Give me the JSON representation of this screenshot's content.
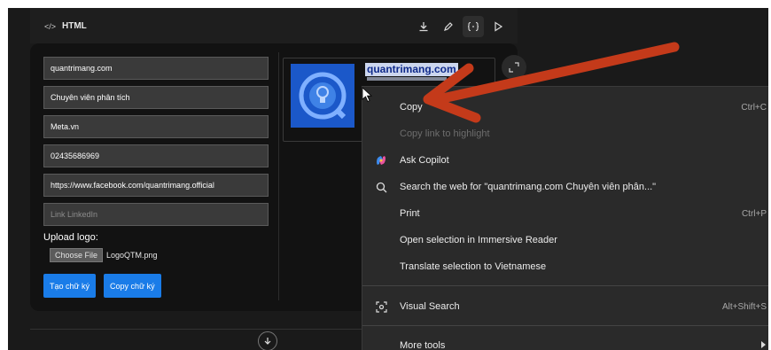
{
  "panel": {
    "title": "HTML"
  },
  "form": {
    "fields": [
      {
        "value": "quantrimang.com"
      },
      {
        "value": "Chuyên viên phân tích"
      },
      {
        "value": "Meta.vn"
      },
      {
        "value": "02435686969"
      },
      {
        "value": "https://www.facebook.com/quantrimang.official"
      }
    ],
    "linkedin_placeholder": "Link LinkedIn",
    "upload_label": "Upload logo:",
    "choose_file_label": "Choose File",
    "file_name": "LogoQTM.png",
    "create_button": "Tạo chữ ký",
    "copy_button": "Copy chữ ký"
  },
  "signature": {
    "name": "quantrimang.com"
  },
  "context_menu": {
    "items": [
      {
        "label": "Copy",
        "shortcut": "Ctrl+C",
        "icon": "",
        "disabled": false
      },
      {
        "label": "Copy link to highlight",
        "shortcut": "",
        "icon": "",
        "disabled": true
      },
      {
        "label": "Ask Copilot",
        "shortcut": "",
        "icon": "copilot-icon",
        "disabled": false
      },
      {
        "label": "Search the web for \"quantrimang.com Chuyên viên phân...\"",
        "shortcut": "",
        "icon": "search-icon",
        "disabled": false
      },
      {
        "label": "Print",
        "shortcut": "Ctrl+P",
        "icon": "",
        "disabled": false
      },
      {
        "label": "Open selection in Immersive Reader",
        "shortcut": "",
        "icon": "",
        "disabled": false
      },
      {
        "label": "Translate selection to Vietnamese",
        "shortcut": "",
        "icon": "",
        "disabled": false
      },
      {
        "label": "Visual Search",
        "shortcut": "Alt+Shift+S",
        "icon": "visual-search-icon",
        "disabled": false
      },
      {
        "label": "More tools",
        "shortcut": "",
        "icon": "",
        "disabled": false
      }
    ]
  },
  "colors": {
    "accent_blue": "#1a7ce8",
    "logo_blue": "#1b58c9",
    "annotation_arrow": "#c43a1a",
    "menu_bg": "#2a2a2a"
  }
}
